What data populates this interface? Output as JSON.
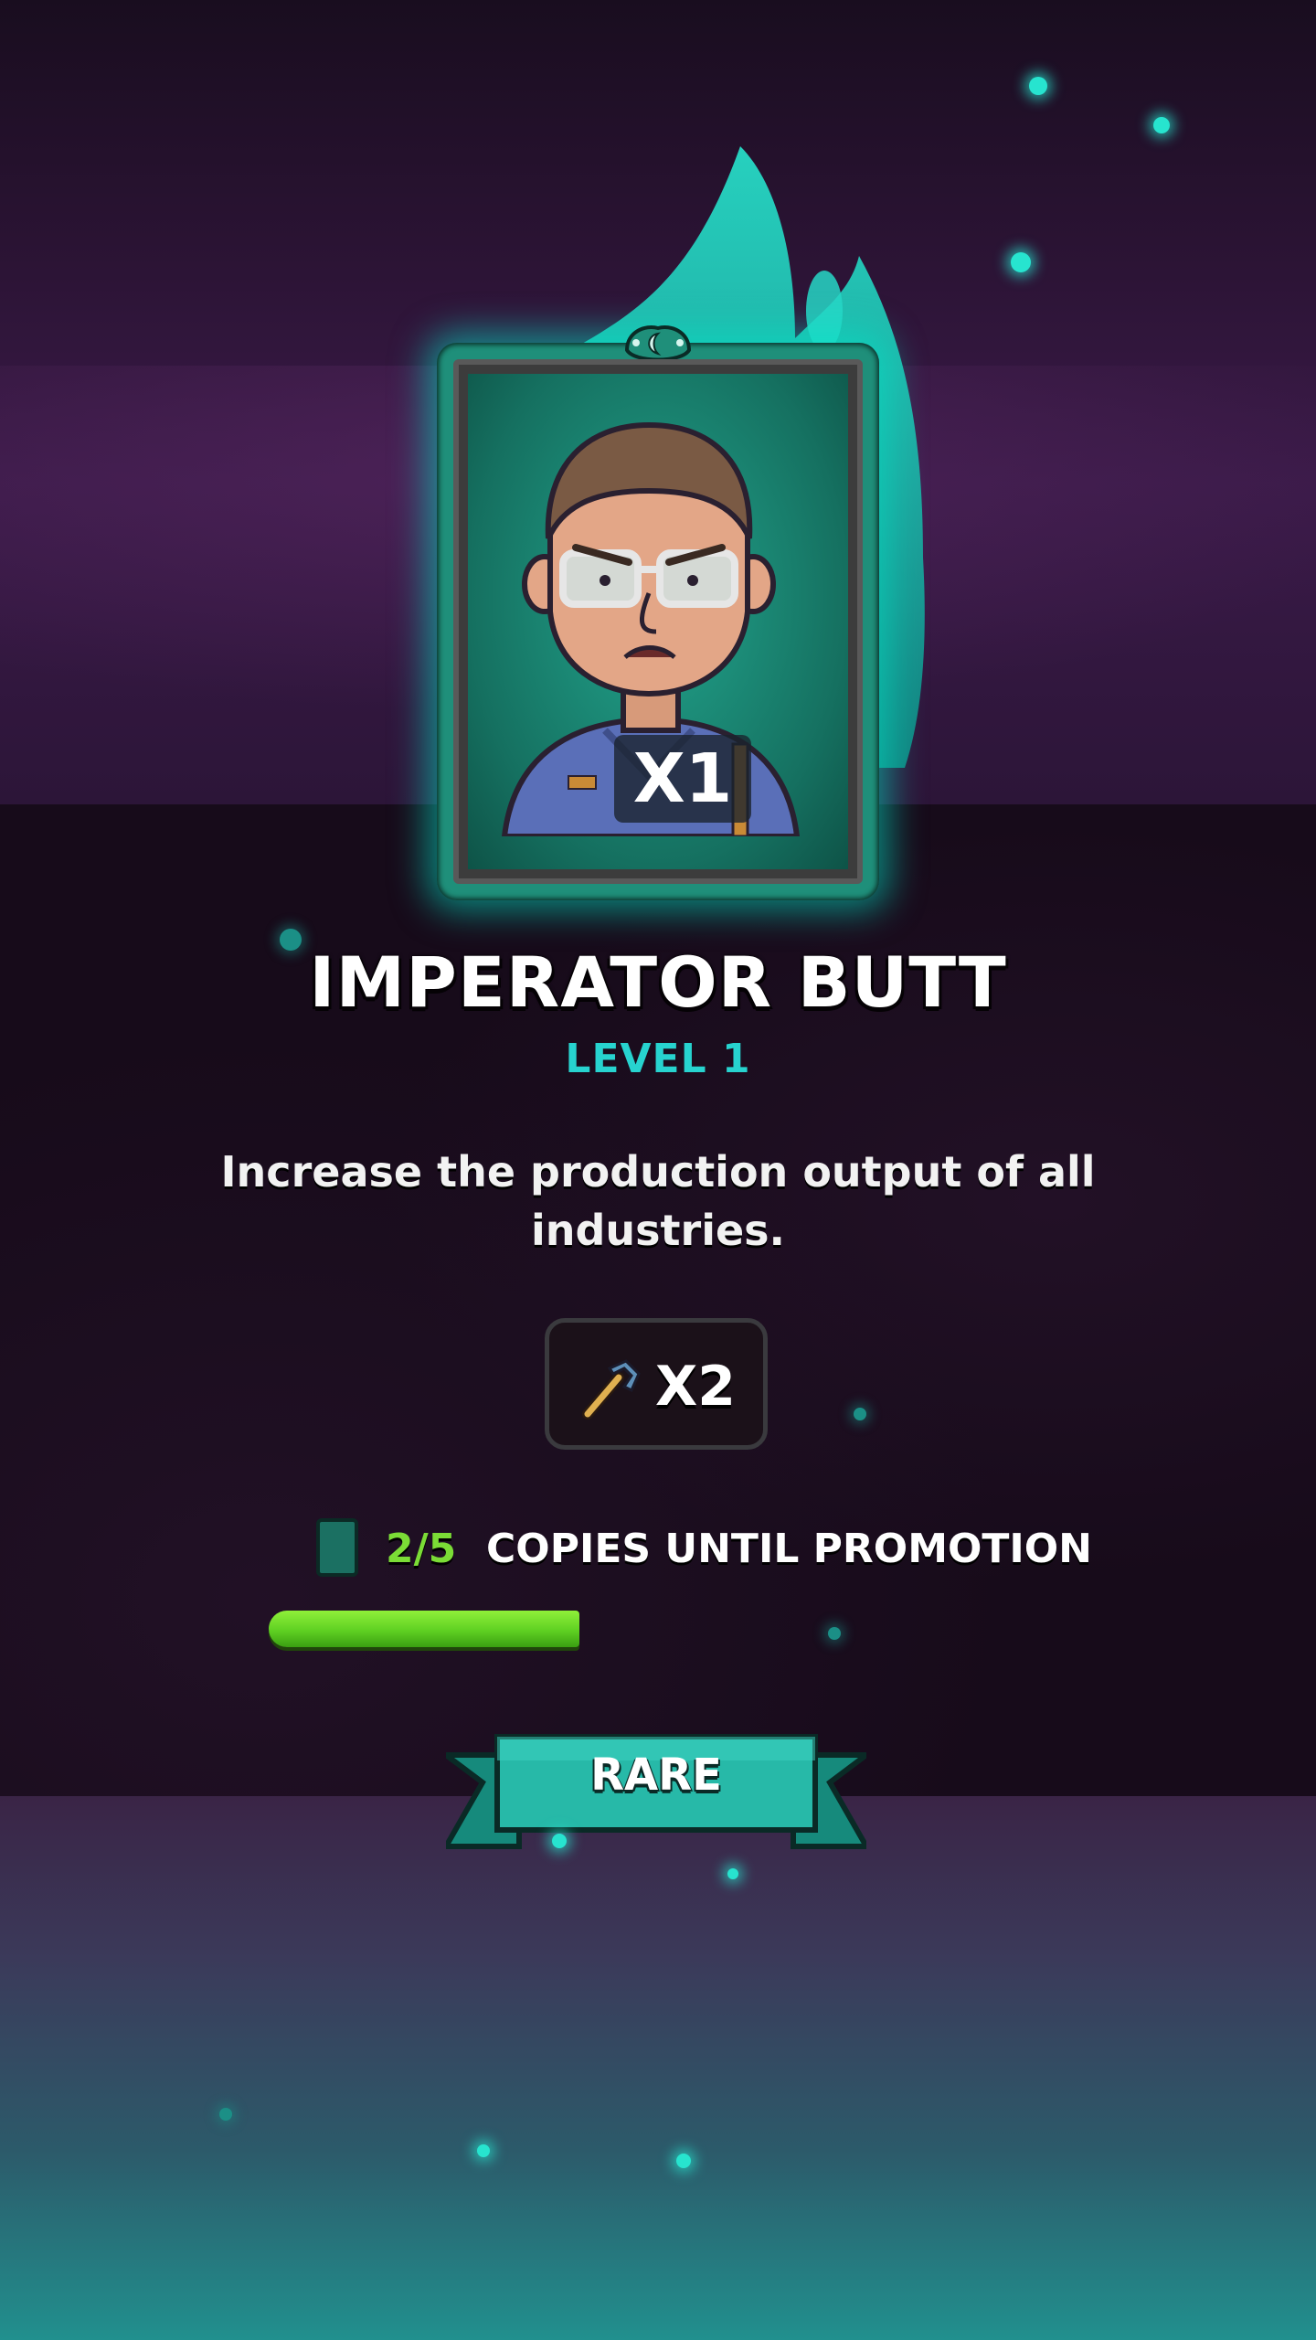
{
  "card": {
    "count_label": "X1",
    "rarity_label": "RARE"
  },
  "character": {
    "name": "IMPERATOR BUTT",
    "level_label": "LEVEL 1",
    "description": "Increase the production output of all industries."
  },
  "bonus": {
    "icon": "hammer-icon",
    "multiplier": "X2"
  },
  "promotion": {
    "count": "2/5",
    "label": "COPIES UNTIL PROMOTION",
    "progress_fraction": 0.4
  },
  "colors": {
    "accent": "#27d3cf",
    "progress_green": "#6ad82a",
    "card_frame": "#1f8f7a"
  }
}
